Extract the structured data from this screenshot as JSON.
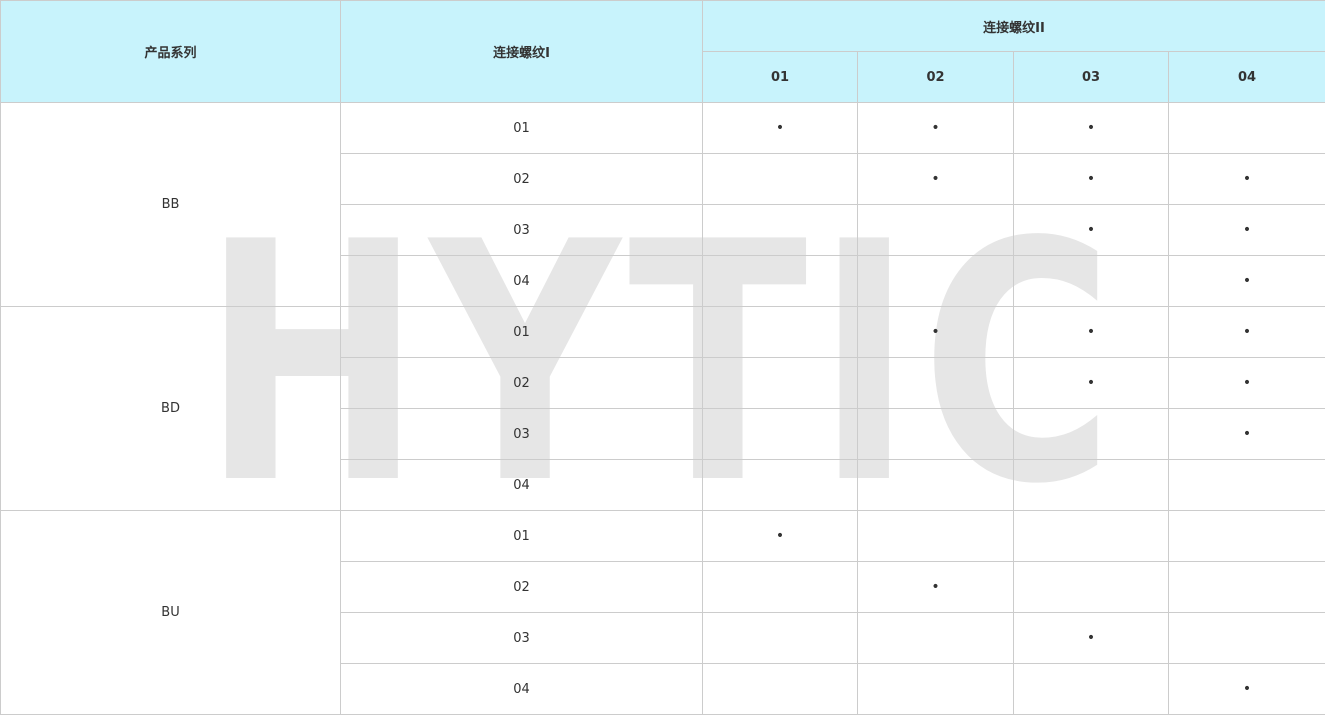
{
  "watermark": {
    "text": "HYTIC",
    "color": "#e6e6e6"
  },
  "colors": {
    "header_bg": "#c8f3fc",
    "border": "#cccccc",
    "text": "#333333"
  },
  "header": {
    "series_label": "产品系列",
    "thread1_label": "连接螺纹I",
    "thread2_label": "连接螺纹II",
    "thread2_cols": [
      "01",
      "02",
      "03",
      "04"
    ]
  },
  "dot_symbol": "•",
  "groups": [
    {
      "series": "BB",
      "rows": [
        {
          "thread1": "01",
          "marks": [
            true,
            true,
            true,
            false
          ]
        },
        {
          "thread1": "02",
          "marks": [
            false,
            true,
            true,
            true
          ]
        },
        {
          "thread1": "03",
          "marks": [
            false,
            false,
            true,
            true
          ]
        },
        {
          "thread1": "04",
          "marks": [
            false,
            false,
            false,
            true
          ]
        }
      ]
    },
    {
      "series": "BD",
      "rows": [
        {
          "thread1": "01",
          "marks": [
            false,
            true,
            true,
            true
          ]
        },
        {
          "thread1": "02",
          "marks": [
            false,
            false,
            true,
            true
          ]
        },
        {
          "thread1": "03",
          "marks": [
            false,
            false,
            false,
            true
          ]
        },
        {
          "thread1": "04",
          "marks": [
            false,
            false,
            false,
            false
          ]
        }
      ]
    },
    {
      "series": "BU",
      "rows": [
        {
          "thread1": "01",
          "marks": [
            true,
            false,
            false,
            false
          ]
        },
        {
          "thread1": "02",
          "marks": [
            false,
            true,
            false,
            false
          ]
        },
        {
          "thread1": "03",
          "marks": [
            false,
            false,
            true,
            false
          ]
        },
        {
          "thread1": "04",
          "marks": [
            false,
            false,
            false,
            true
          ]
        }
      ]
    }
  ]
}
